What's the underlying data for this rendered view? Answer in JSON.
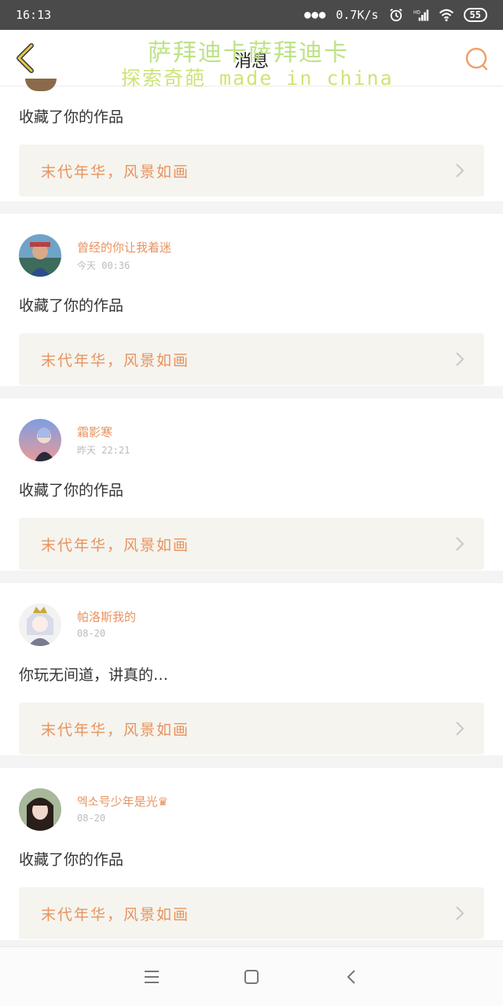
{
  "status_bar": {
    "time": "16:13",
    "network_speed": "0.7K/s",
    "battery": "55",
    "icons": [
      "signal-dots-icon",
      "alarm-icon",
      "hd-signal-icon",
      "wifi-icon",
      "battery-icon"
    ]
  },
  "header": {
    "title": "消息",
    "back_icon": "chevron-left-icon",
    "search_icon": "search-icon"
  },
  "watermark": {
    "line1": "萨拜迪卡萨拜迪卡",
    "line2": "探索奇葩 made in china"
  },
  "colors": {
    "accent": "#e8935f",
    "link_bg": "#f5f4ee",
    "back_arrow": "#d9b130"
  },
  "notifications": [
    {
      "message": "收藏了你的作品",
      "work_title": "末代年华，风景如画"
    },
    {
      "username": "曾经的你让我着迷",
      "timestamp": "今天 00:36",
      "message": "收藏了你的作品",
      "work_title": "末代年华，风景如画"
    },
    {
      "username": "霜影寒",
      "timestamp": "昨天 22:21",
      "message": "收藏了你的作品",
      "work_title": "末代年华，风景如画"
    },
    {
      "username": "帕洛斯我的",
      "timestamp": "08-20",
      "message": "你玩无间道，讲真的…",
      "work_title": "末代年华，风景如画"
    },
    {
      "username": "엑소号少年是光♛",
      "timestamp": "08-20",
      "message": "收藏了你的作品",
      "work_title": "末代年华，风景如画"
    }
  ],
  "nav_bar": {
    "icons": [
      "menu-icon",
      "home-icon",
      "back-icon"
    ]
  }
}
